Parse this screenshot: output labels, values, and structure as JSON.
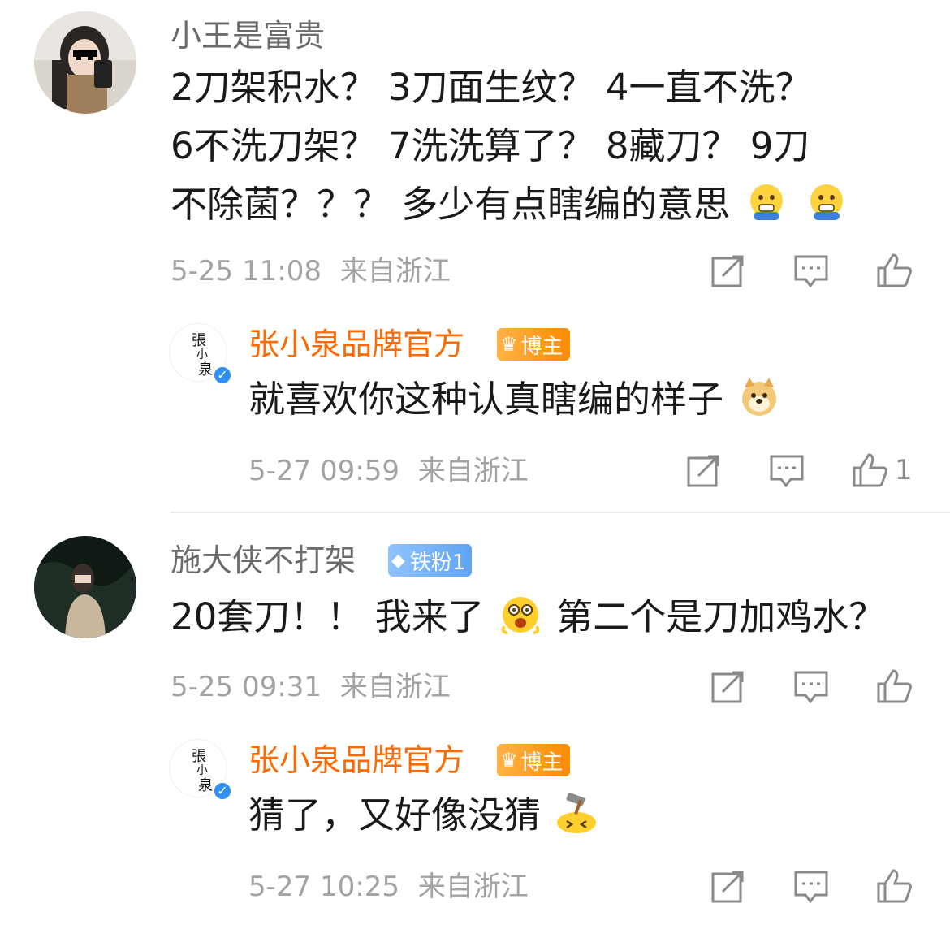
{
  "comments": [
    {
      "username": "小王是富贵",
      "text_lines": [
        "2刀架积水？ 3刀面生纹？ 4一直不洗？",
        "6不洗刀架？ 7洗洗算了？ 8藏刀？ 9刀",
        "不除菌？？？ 多少有点瞎编的意思"
      ],
      "time": "5-25 11:08",
      "location": "来自浙江",
      "reply": {
        "username": "张小泉品牌官方",
        "badge": "博主",
        "text": "就喜欢你这种认真瞎编的样子",
        "time": "5-27 09:59",
        "location": "来自浙江",
        "likes": "1"
      }
    },
    {
      "username": "施大侠不打架",
      "badge": "铁粉1",
      "text_part1": "20套刀！！ 我来了",
      "text_part2": "第二个是刀加鸡水？",
      "time": "5-25 09:31",
      "location": "来自浙江",
      "reply": {
        "username": "张小泉品牌官方",
        "badge": "博主",
        "text": "猜了，又好像没猜",
        "time": "5-27 10:25",
        "location": "来自浙江"
      }
    }
  ],
  "colors": {
    "official": "#ff6a00",
    "meta": "#a3a3a3",
    "username": "#6b6b6b"
  },
  "icons": [
    "share-icon",
    "comment-icon",
    "like-icon"
  ]
}
